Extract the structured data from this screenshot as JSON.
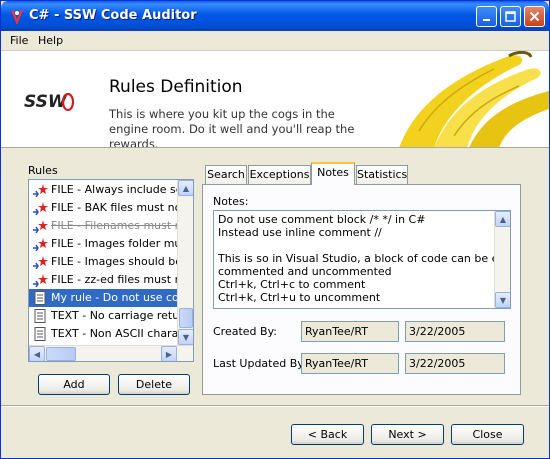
{
  "window": {
    "title": "C# - SSW Code Auditor"
  },
  "menu": {
    "file": "File",
    "help": "Help"
  },
  "header": {
    "title": "Rules Definition",
    "description": "This is where you kit up the cogs in the engine room. Do it well and you'll reap the rewards.",
    "logo_text": "SSW"
  },
  "rules": {
    "label": "Rules",
    "items": [
      {
        "label": "FILE - Always include setup"
      },
      {
        "label": "FILE - BAK files must not exist"
      },
      {
        "label": "FILE - Filenames must not"
      },
      {
        "label": "FILE - Images folder must"
      },
      {
        "label": "FILE - Images should be in"
      },
      {
        "label": "FILE - zz-ed files must not"
      },
      {
        "label": "My rule - Do not use comm"
      },
      {
        "label": "TEXT - No carriage returns"
      },
      {
        "label": "TEXT - Non ASCII characters"
      }
    ],
    "add_label": "Add",
    "delete_label": "Delete"
  },
  "tabs": {
    "search": "Search",
    "exceptions": "Exceptions",
    "notes": "Notes",
    "statistics": "Statistics"
  },
  "notes": {
    "label": "Notes:",
    "lines": [
      "Do not use comment block /* */ in C#",
      "Instead use inline comment //",
      "",
      "This is so in Visual Studio, a block of code can be easily",
      "commented and uncommented",
      "Ctrl+k, Ctrl+c to comment",
      "Ctrl+k, Ctrl+u to uncomment"
    ],
    "created_by_label": "Created By:",
    "created_by": "RyanTee/RT",
    "created_date": "3/22/2005",
    "updated_by_label": "Last Updated By:",
    "updated_by": "RyanTee/RT",
    "updated_date": "3/22/2005"
  },
  "footer": {
    "back_label": "< Back",
    "next_label": "Next >",
    "close_label": "Close"
  },
  "colors": {
    "titlebar": "#0054e3",
    "selection": "#316ac5",
    "tab_active_accent": "#ffc83c"
  }
}
